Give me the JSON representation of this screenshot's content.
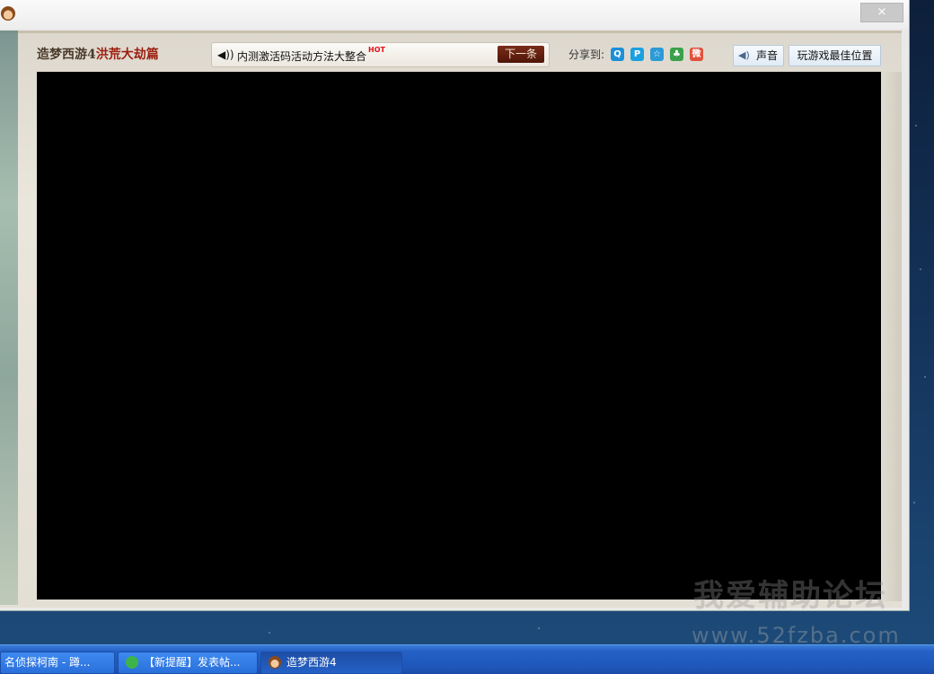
{
  "window": {
    "close_glyph": "×"
  },
  "game": {
    "title_main": "造梦西游4",
    "title_sub": "洪荒大劫篇",
    "notice": {
      "text": "内测激活码活动方法大整合",
      "hot": "HOT",
      "next_label": "下一条"
    },
    "share": {
      "label": "分享到:",
      "icons": [
        {
          "name": "qq-icon",
          "color": "#1c8fd8",
          "glyph": "Q"
        },
        {
          "name": "qzone-icon",
          "color": "#1aa0e0",
          "glyph": "P"
        },
        {
          "name": "star-icon",
          "color": "#2c9ad6",
          "glyph": "☆"
        },
        {
          "name": "clover-icon",
          "color": "#3aa04a",
          "glyph": "♣"
        },
        {
          "name": "weibo-icon",
          "color": "#e0503a",
          "glyph": "微"
        }
      ]
    },
    "sound_label": "声音",
    "best_position_label": "玩游戏最佳位置"
  },
  "watermark": {
    "text": "我爱辅助论坛",
    "url": "www.52fzba.com"
  },
  "taskbar": {
    "items": [
      {
        "label": "名侦探柯南 - 蹲..."
      },
      {
        "label": "【新提醒】发表帖..."
      },
      {
        "label": "造梦西游4"
      }
    ]
  }
}
